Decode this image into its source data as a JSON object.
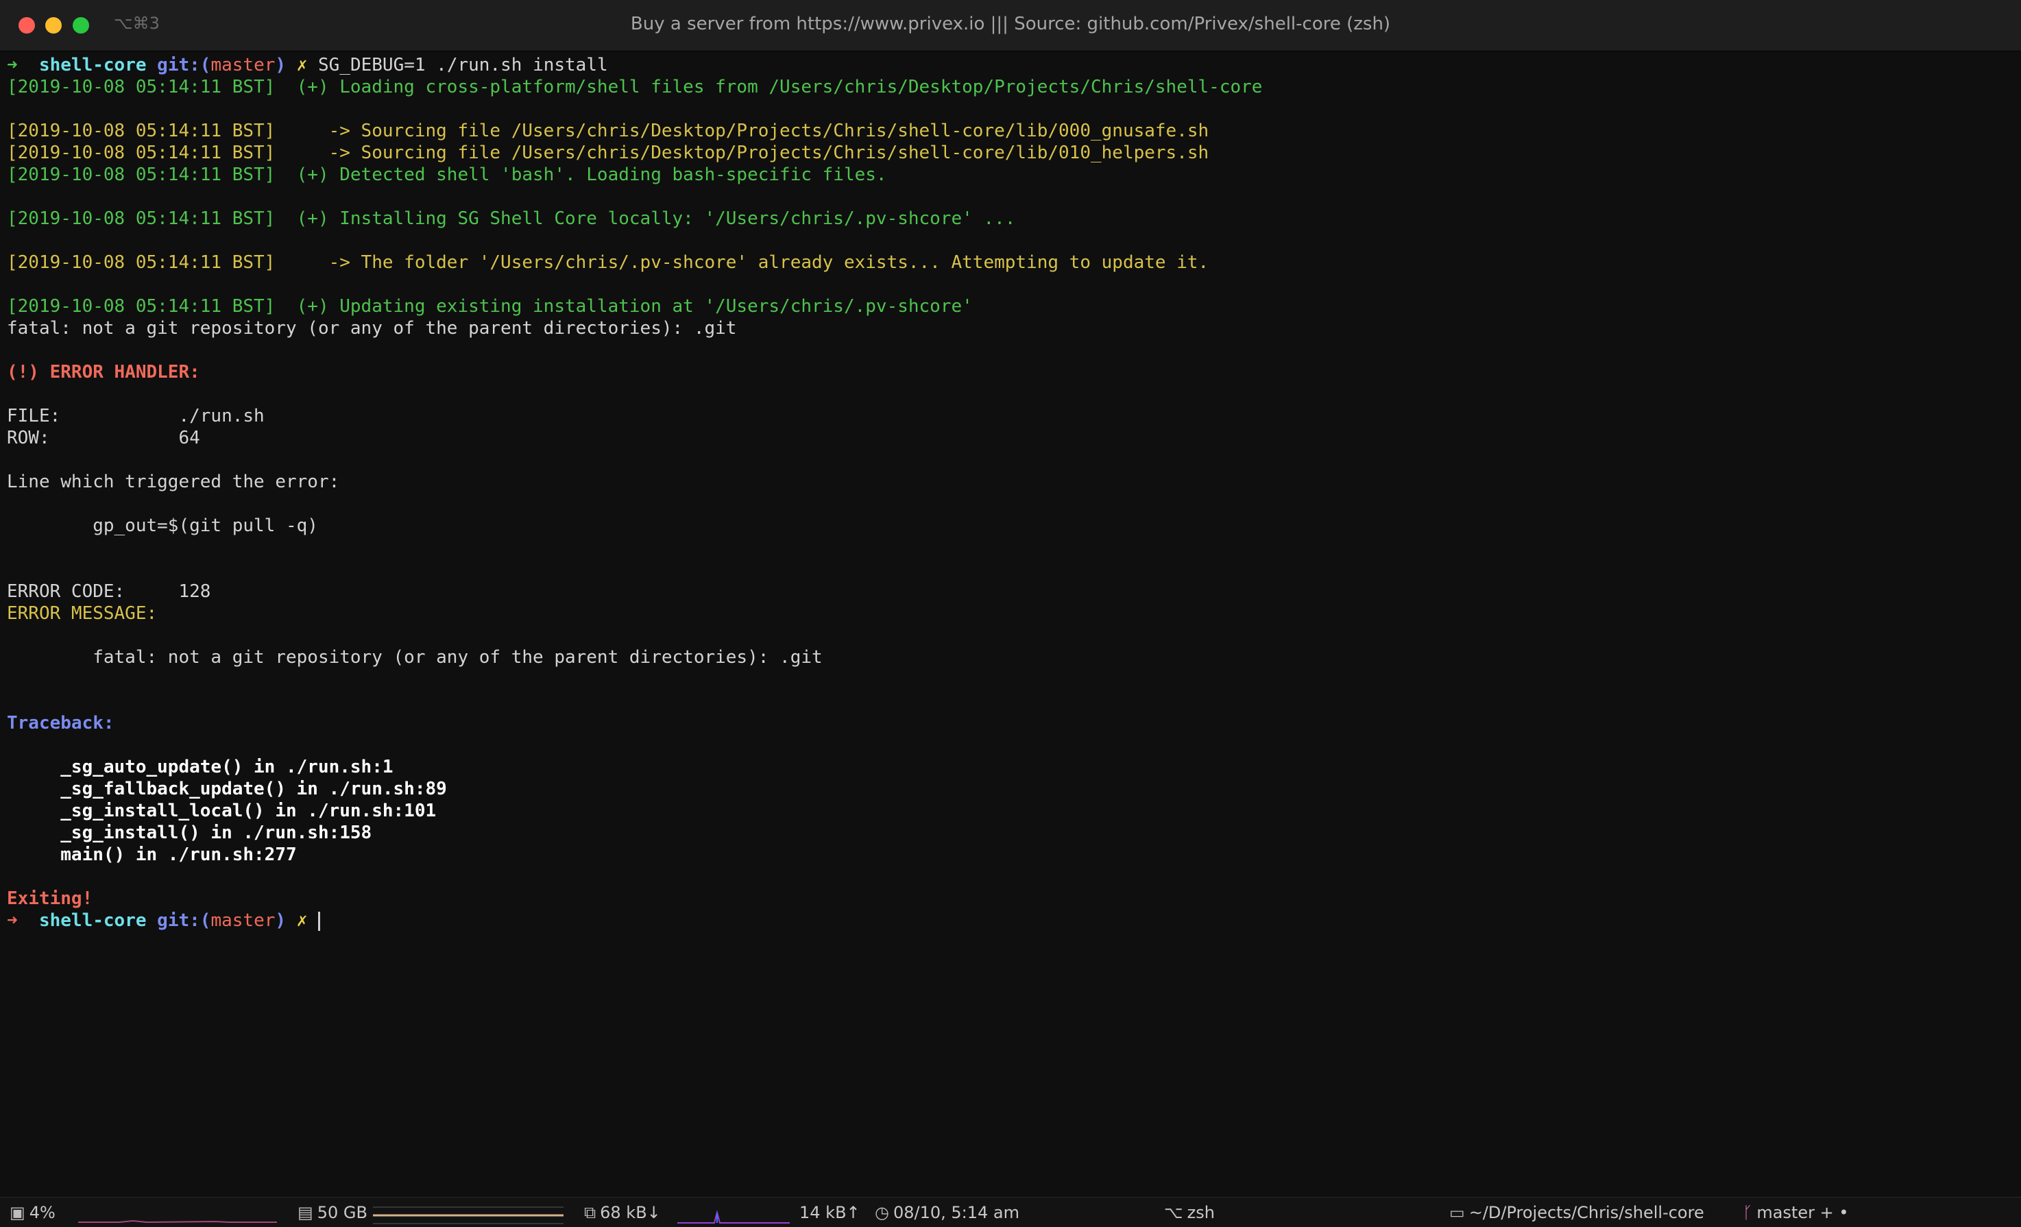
{
  "window": {
    "title": "Buy a server from https://www.privex.io ||| Source: github.com/Privex/shell-core (zsh)",
    "tab_shortcut": "⌥⌘3"
  },
  "terminal": {
    "prompt": {
      "arrow": "➜",
      "dir": "shell-core",
      "git_label": "git:(",
      "branch": "master",
      "git_close": ")",
      "dirty_mark": "✗"
    },
    "command": "SG_DEBUG=1 ./run.sh install",
    "lines": {
      "l1": "[2019-10-08 05:14:11 BST]  (+) Loading cross-platform/shell files from /Users/chris/Desktop/Projects/Chris/shell-core",
      "l2": "[2019-10-08 05:14:11 BST]     -> Sourcing file /Users/chris/Desktop/Projects/Chris/shell-core/lib/000_gnusafe.sh",
      "l3": "[2019-10-08 05:14:11 BST]     -> Sourcing file /Users/chris/Desktop/Projects/Chris/shell-core/lib/010_helpers.sh",
      "l4": "[2019-10-08 05:14:11 BST]  (+) Detected shell 'bash'. Loading bash-specific files.",
      "l5": "[2019-10-08 05:14:11 BST]  (+) Installing SG Shell Core locally: '/Users/chris/.pv-shcore' ...",
      "l6": "[2019-10-08 05:14:11 BST]     -> The folder '/Users/chris/.pv-shcore' already exists... Attempting to update it.",
      "l7": "[2019-10-08 05:14:11 BST]  (+) Updating existing installation at '/Users/chris/.pv-shcore'",
      "fatal": "fatal: not a git repository (or any of the parent directories): .git",
      "error_handler": "(!) ERROR HANDLER:",
      "file_row": "FILE:           ./run.sh",
      "row_row": "ROW:            64",
      "trigger_label": "Line which triggered the error:",
      "trigger_code": "        gp_out=$(git pull -q)",
      "error_code": "ERROR CODE:     128",
      "error_message": "ERROR MESSAGE:",
      "error_message_body": "        fatal: not a git repository (or any of the parent directories): .git",
      "traceback": "Traceback:",
      "tb1": "     _sg_auto_update() in ./run.sh:1",
      "tb2": "     _sg_fallback_update() in ./run.sh:89",
      "tb3": "     _sg_install_local() in ./run.sh:101",
      "tb4": "     _sg_install() in ./run.sh:158",
      "tb5": "     main() in ./run.sh:277",
      "exiting": "Exiting!"
    }
  },
  "statusbar": {
    "cpu": "4%",
    "disk": "50 GB",
    "net_down": "68 kB↓",
    "net_up": "14 kB↑",
    "clock": "08/10, 5:14 am",
    "shell": "zsh",
    "path": "~/D/Projects/Chris/shell-core",
    "git": "master + •",
    "colors": {
      "cpu_graph": "#a2477a",
      "disk_bar": "#d4b48c",
      "net_graph": "#9b3fd6",
      "net_spike": "#4a6cff",
      "git_icon": "#e879c5"
    }
  }
}
